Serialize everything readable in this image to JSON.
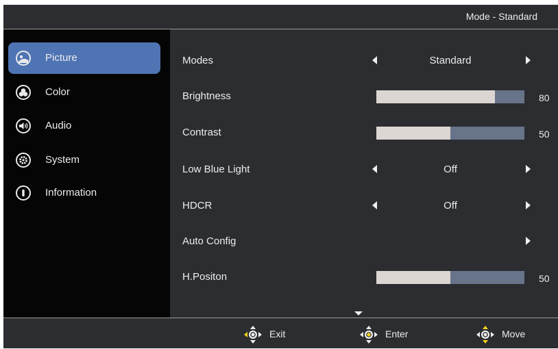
{
  "header": {
    "mode_title": "Mode - Standard"
  },
  "sidebar": {
    "items": [
      {
        "label": "Picture",
        "icon": "picture-icon",
        "active": true
      },
      {
        "label": "Color",
        "icon": "color-icon",
        "active": false
      },
      {
        "label": "Audio",
        "icon": "speaker-icon",
        "active": false
      },
      {
        "label": "System",
        "icon": "gear-icon",
        "active": false
      },
      {
        "label": "Information",
        "icon": "info-icon",
        "active": false
      }
    ]
  },
  "settings": {
    "modes": {
      "label": "Modes",
      "value": "Standard"
    },
    "brightness": {
      "label": "Brightness",
      "value": 80,
      "value_text": "80"
    },
    "contrast": {
      "label": "Contrast",
      "value": 50,
      "value_text": "50"
    },
    "low_blue_light": {
      "label": "Low Blue Light",
      "value": "Off"
    },
    "hdcr": {
      "label": "HDCR",
      "value": "Off"
    },
    "auto_config": {
      "label": "Auto Config"
    },
    "h_position": {
      "label": "H.Positon",
      "value": 50,
      "value_text": "50"
    }
  },
  "footer": {
    "exit_label": "Exit",
    "enter_label": "Enter",
    "move_label": "Move"
  },
  "colors": {
    "background": "#2b2d30",
    "sidebar": "#050505",
    "active_item": "#4f74b3",
    "slider_fill": "#dcd6d2",
    "slider_track": "#67748a",
    "highlight_yellow": "#f5d31a"
  }
}
